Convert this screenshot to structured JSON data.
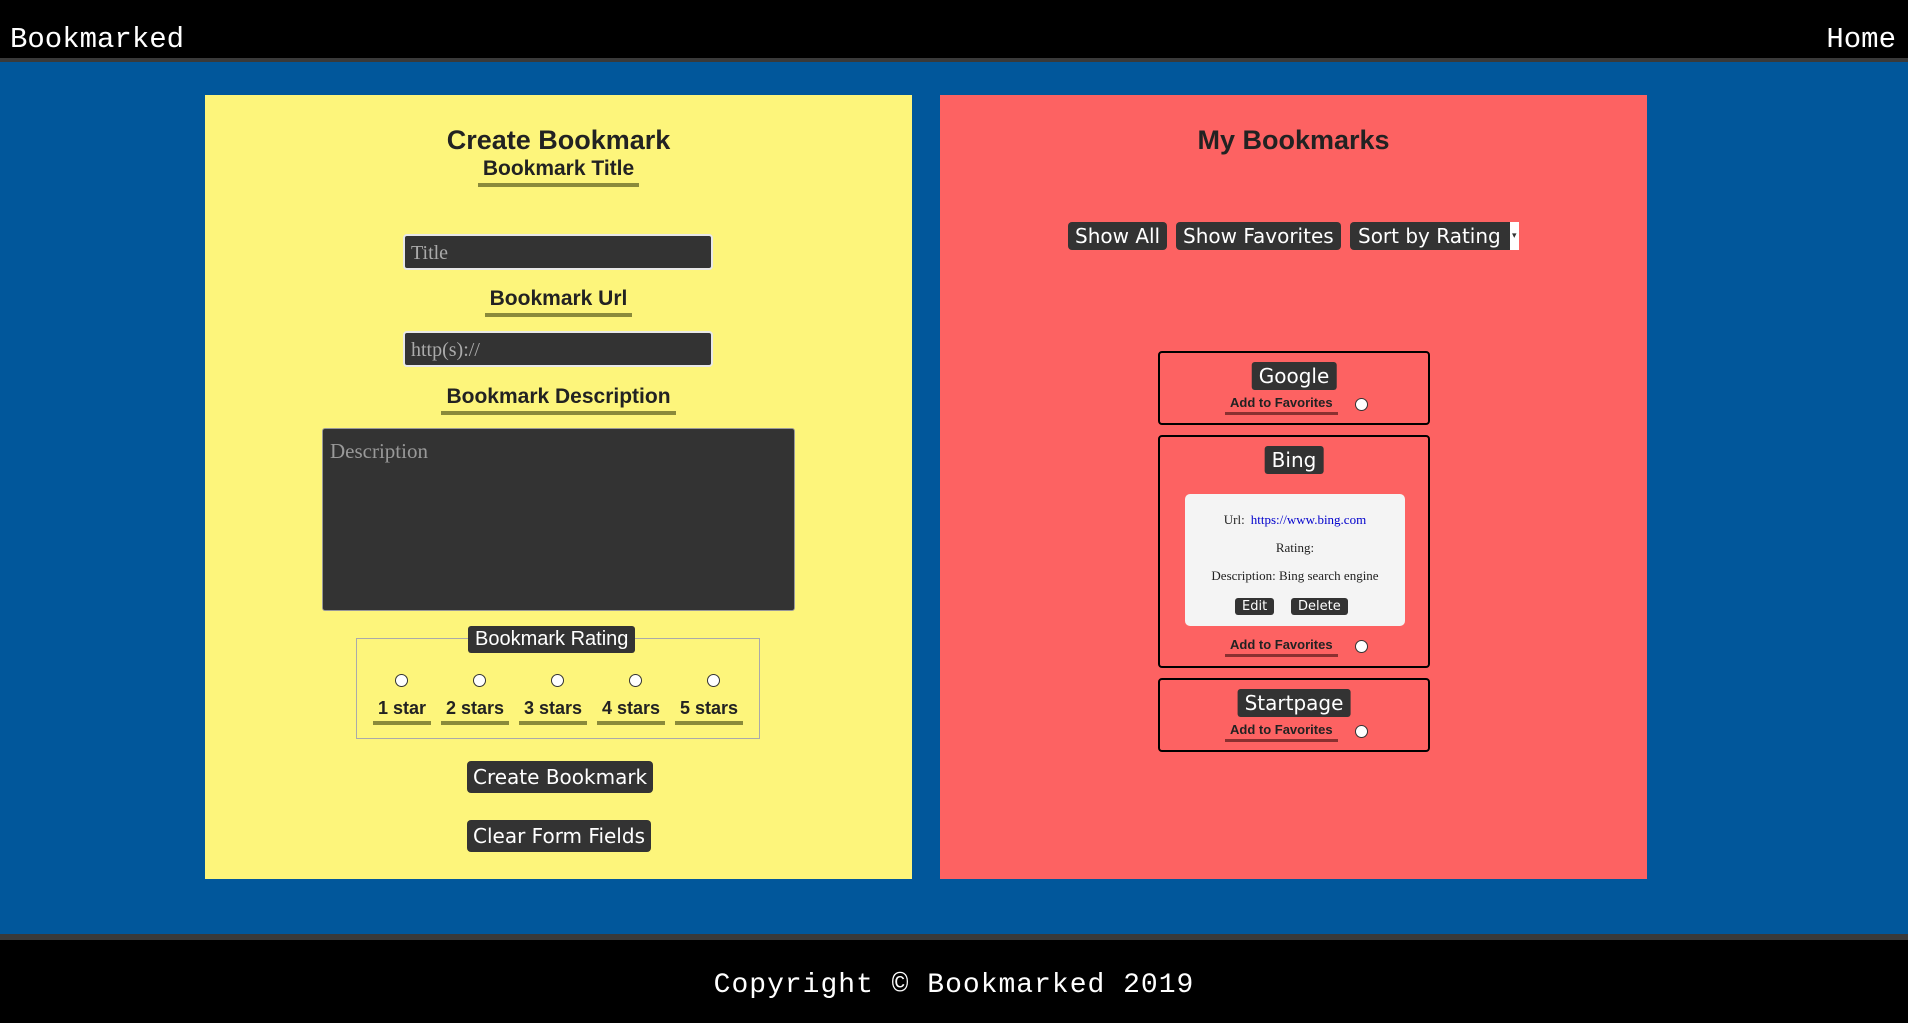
{
  "header": {
    "brand": "Bookmarked",
    "home_link": "Home"
  },
  "create": {
    "title": "Create Bookmark",
    "title_label": "Bookmark Title",
    "title_placeholder": "Title",
    "url_label": "Bookmark Url",
    "url_placeholder": "http(s)://",
    "description_label": "Bookmark Description",
    "description_placeholder": "Description",
    "rating_legend": "Bookmark Rating",
    "rating_options": [
      "1 star",
      "2 stars",
      "3 stars",
      "4 stars",
      "5 stars"
    ],
    "create_button": "Create Bookmark",
    "clear_button": "Clear Form Fields"
  },
  "list": {
    "title": "My Bookmarks",
    "show_all": "Show All",
    "show_favorites": "Show Favorites",
    "sort_select": "Sort by Rating",
    "favorite_label": "Add to Favorites",
    "bookmarks": [
      {
        "title": "Google"
      },
      {
        "title": "Bing",
        "url_label": "Url:",
        "url": "https://www.bing.com",
        "rating_label": "Rating:",
        "description_label": "Description:",
        "description": "Bing search engine",
        "edit_button": "Edit",
        "delete_button": "Delete"
      },
      {
        "title": "Startpage"
      }
    ]
  },
  "footer": {
    "copyright": "Copyright © Bookmarked 2019"
  },
  "colors": {
    "page_background": "#01579b",
    "create_panel": "#fdf57b",
    "list_panel": "#fd6262",
    "dark_control": "#333333",
    "header_footer": "#000000"
  }
}
